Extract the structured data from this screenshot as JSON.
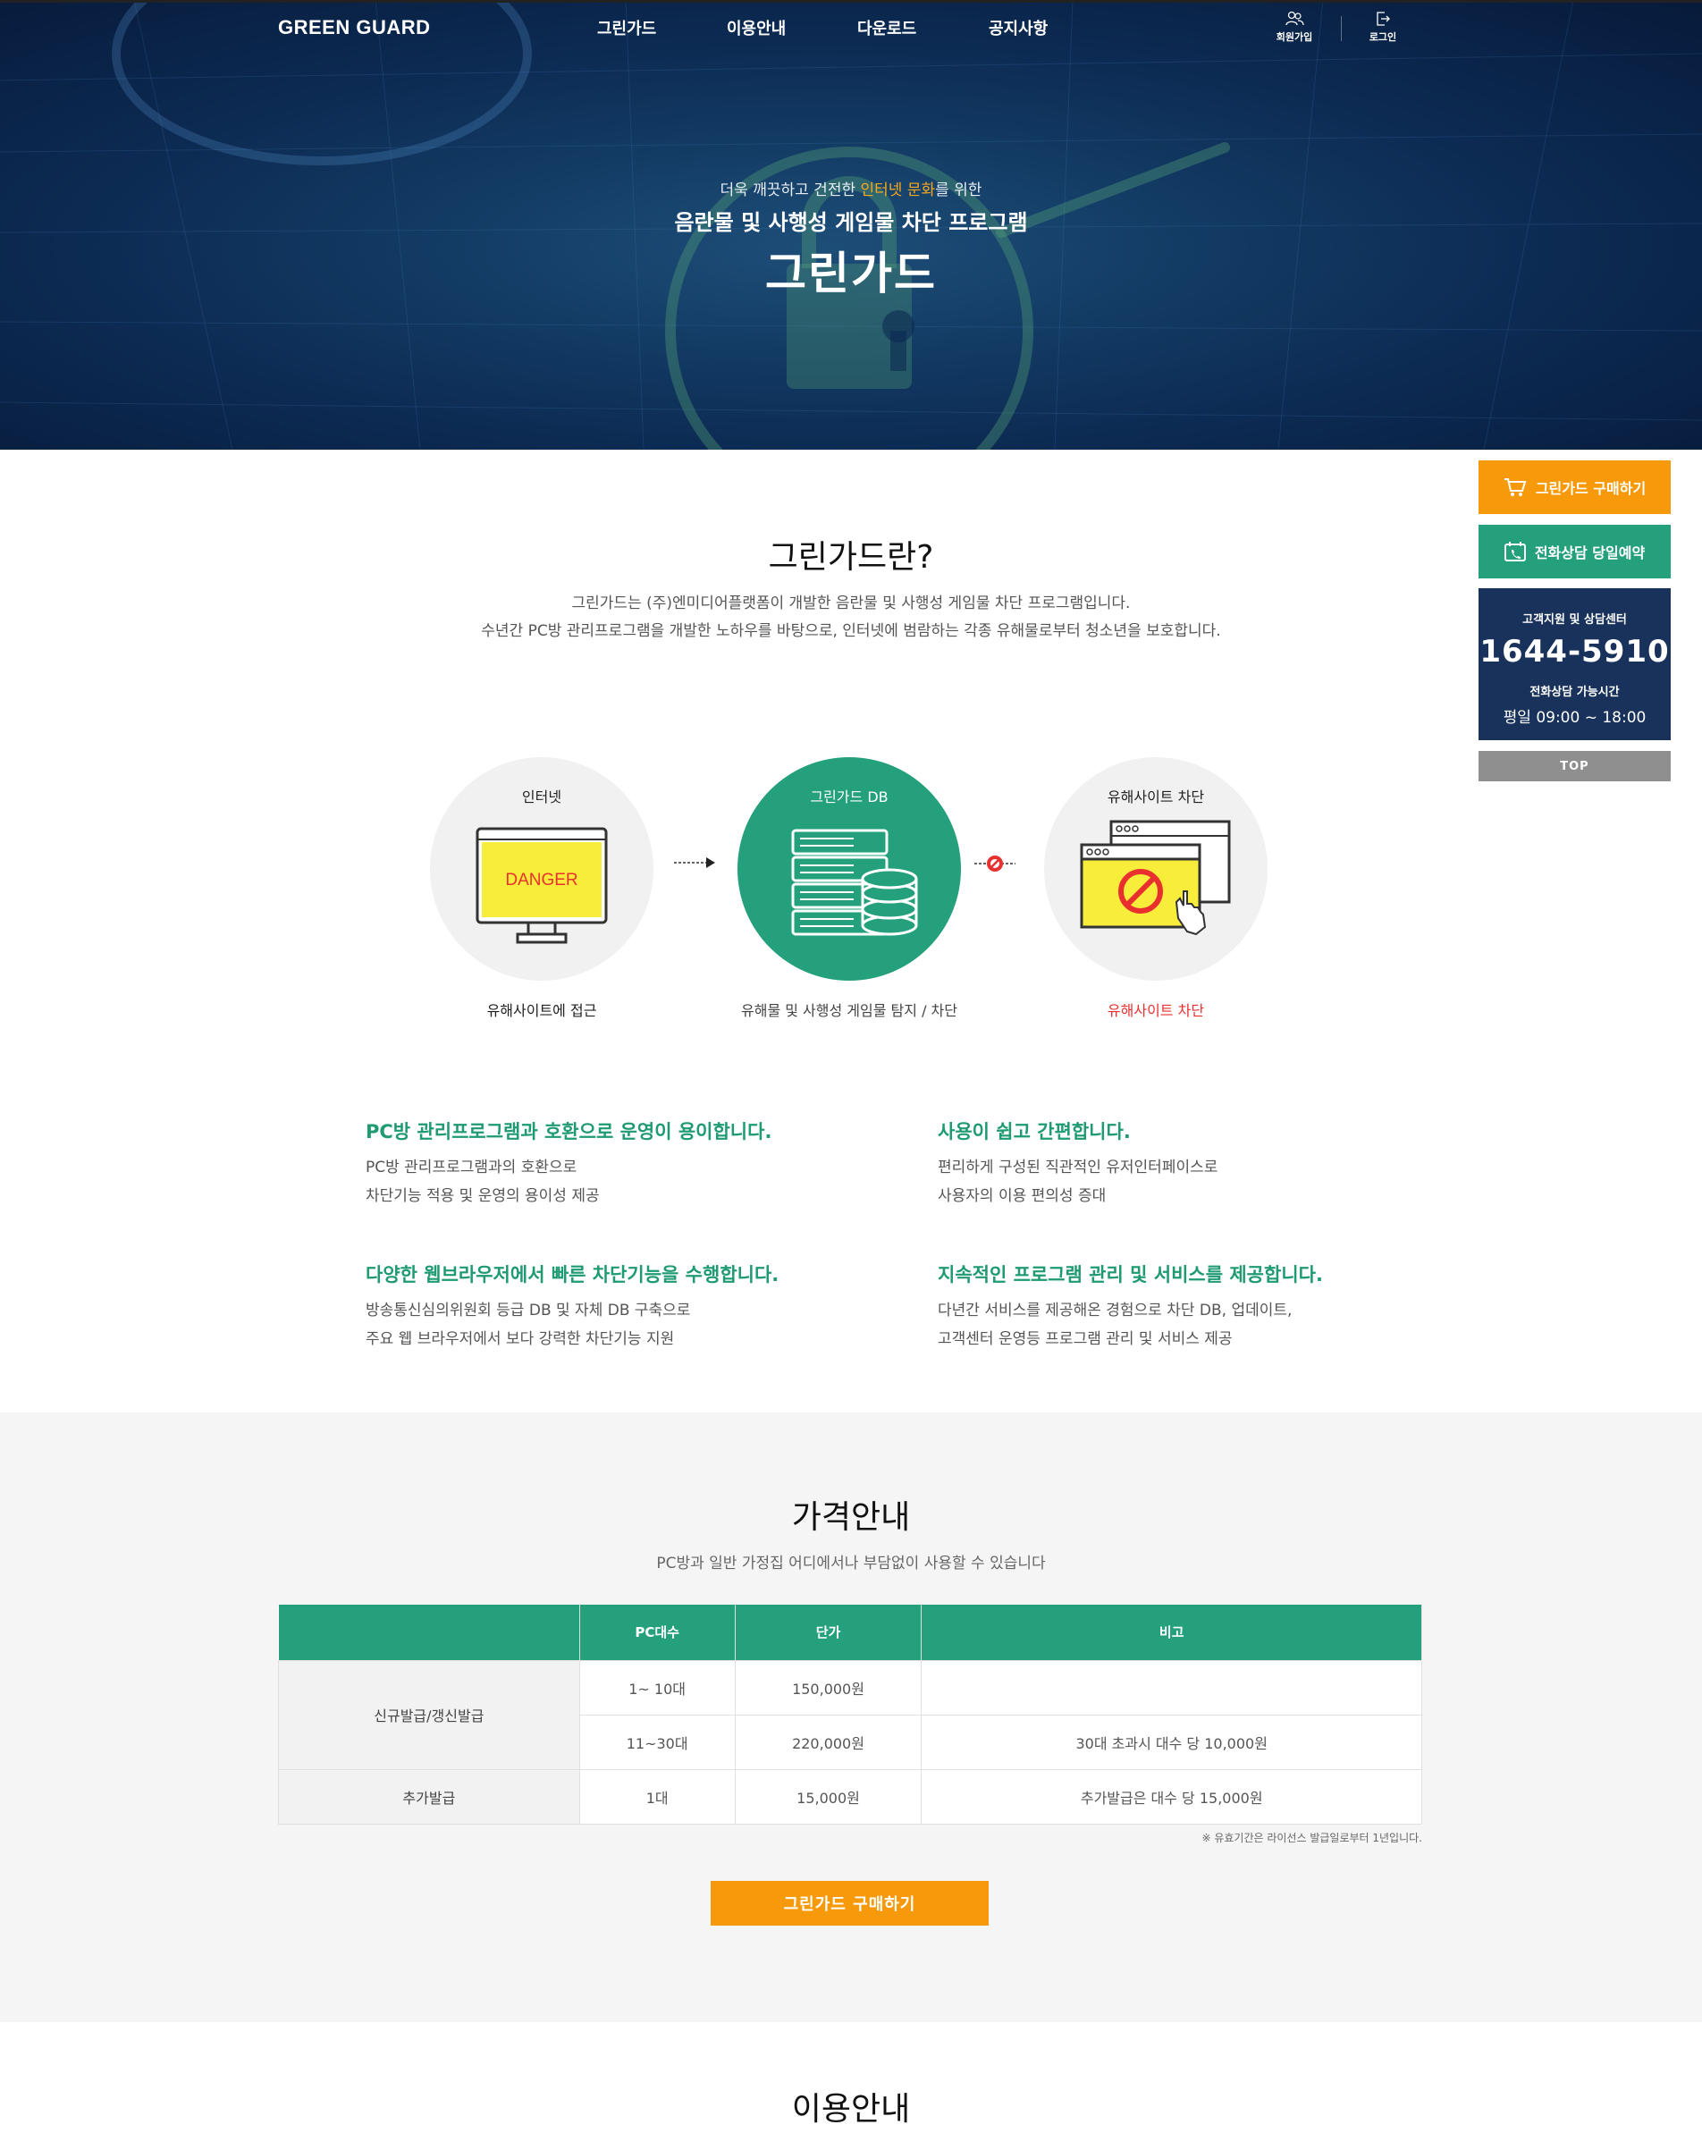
{
  "header": {
    "logo": "GREEN GUARD",
    "nav": [
      "그린가드",
      "이용안내",
      "다운로드",
      "공지사항"
    ],
    "signup_label": "회원가입",
    "login_label": "로그인"
  },
  "hero": {
    "subtitle_pre": "더욱 깨끗하고 건전한 ",
    "subtitle_highlight": "인터넷 문화",
    "subtitle_post": "를 위한",
    "line2": "음란물 및 사행성 게임물 차단 프로그램",
    "title": "그린가드",
    "highlight_color": "#f8a81c"
  },
  "quick_menu": {
    "buy_label": "그린가드 구매하기",
    "call_label": "전화상담 당일예약",
    "support_label": "고객지원 및 상담센터",
    "phone": "1644-5910",
    "hours_label": "전화상담 가능시간",
    "hours": "평일 09:00 ~ 18:00",
    "top_label": "TOP"
  },
  "about": {
    "title": "그린가드란?",
    "desc1": "그린가드는 (주)엔미디어플랫폼이 개발한 음란물 및 사행성 게임물 차단 프로그램입니다.",
    "desc2": "수년간 PC방 관리프로그램을 개발한 노하우를 바탕으로, 인터넷에 범람하는 각종 유해물로부터 청소년을 보호합니다.",
    "diagram": [
      {
        "label": "인터넷",
        "caption": "유해사이트에 접근",
        "screen_text": "DANGER"
      },
      {
        "label": "그린가드 DB",
        "caption": "유해물 및 사행성 게임물 탐지 / 차단"
      },
      {
        "label": "유해사이트 차단",
        "caption": "유해사이트 차단"
      }
    ],
    "features": [
      {
        "title": "PC방 관리프로그램과 호환으로 운영이 용이합니다.",
        "line1": "PC방 관리프로그램과의 호환으로",
        "line2": "차단기능 적용 및 운영의 용이성 제공"
      },
      {
        "title": "사용이 쉽고 간편합니다.",
        "line1": "편리하게 구성된 직관적인 유저인터페이스로",
        "line2": "사용자의 이용 편의성 증대"
      },
      {
        "title": "다양한 웹브라우저에서 빠른 차단기능을 수행합니다.",
        "line1": "방송통신심의위원회 등급 DB 및 자체 DB 구축으로",
        "line2": "주요 웹 브라우저에서 보다 강력한 차단기능 지원"
      },
      {
        "title": "지속적인 프로그램 관리 및 서비스를 제공합니다.",
        "line1": "다년간 서비스를 제공해온 경험으로 차단 DB, 업데이트,",
        "line2": "고객센터 운영등 프로그램 관리 및 서비스 제공"
      }
    ],
    "accent_color": "#25a07d",
    "block_color": "#e8312f"
  },
  "pricing": {
    "title": "가격안내",
    "subtitle": "PC방과 일반 가정집 어디에서나 부담없이 사용할 수 있습니다",
    "headers": [
      "",
      "PC대수",
      "단가",
      "비고"
    ],
    "rows": [
      {
        "type": "신규발급/갱신발급",
        "pcs": "1~ 10대",
        "price": "150,000원",
        "note": ""
      },
      {
        "type": "",
        "pcs": "11~30대",
        "price": "220,000원",
        "note": "30대 초과시 대수 당 10,000원"
      },
      {
        "type": "추가발급",
        "pcs": "1대",
        "price": "15,000원",
        "note": "추가발급은 대수 당 15,000원"
      }
    ],
    "footnote": "※ 유효기간은 라이선스 발급일로부터 1년입니다.",
    "buy_label": "그린가드 구매하기",
    "buy_color": "#f69a0b"
  },
  "guide": {
    "title": "이용안내"
  }
}
